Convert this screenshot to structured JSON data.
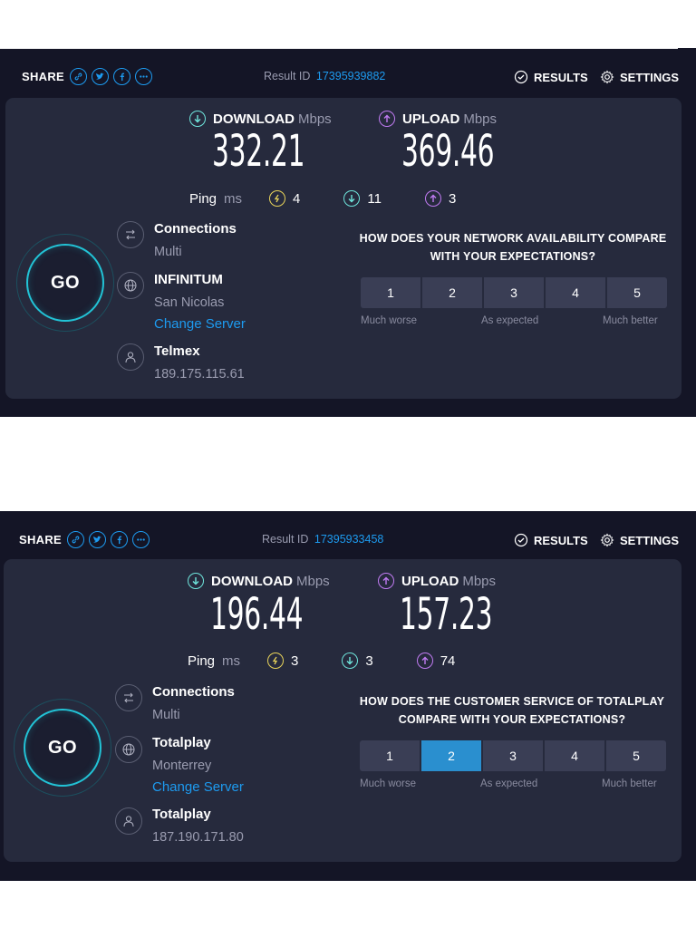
{
  "colors": {
    "accent": "#1d9bf0",
    "download": "#6fe5dc",
    "upload": "#c07bf2",
    "jitter": "#e8d35a",
    "go_ring": "#22c3d6",
    "selected_rating": "#2a8fcf"
  },
  "results": [
    {
      "share_label": "SHARE",
      "result_id_label": "Result ID",
      "result_id": "17395939882",
      "results_label": "RESULTS",
      "settings_label": "SETTINGS",
      "download_label": "DOWNLOAD",
      "upload_label": "UPLOAD",
      "unit": "Mbps",
      "download_value": "332.21",
      "upload_value": "369.46",
      "ping_label": "Ping",
      "ping_unit": "ms",
      "ping_idle": "4",
      "ping_download": "11",
      "ping_upload": "3",
      "go_label": "GO",
      "connections_title": "Connections",
      "connections_value": "Multi",
      "server_title": "INFINITUM",
      "server_location": "San Nicolas",
      "change_server": "Change Server",
      "isp_title": "Telmex",
      "ip_address": "189.175.115.61",
      "question": "HOW DOES YOUR NETWORK AVAILABILITY COMPARE WITH YOUR EXPECTATIONS?",
      "rating_options": [
        "1",
        "2",
        "3",
        "4",
        "5"
      ],
      "selected_rating": null,
      "scale_low": "Much worse",
      "scale_mid": "As expected",
      "scale_high": "Much better"
    },
    {
      "share_label": "SHARE",
      "result_id_label": "Result ID",
      "result_id": "17395933458",
      "results_label": "RESULTS",
      "settings_label": "SETTINGS",
      "download_label": "DOWNLOAD",
      "upload_label": "UPLOAD",
      "unit": "Mbps",
      "download_value": "196.44",
      "upload_value": "157.23",
      "ping_label": "Ping",
      "ping_unit": "ms",
      "ping_idle": "3",
      "ping_download": "3",
      "ping_upload": "74",
      "go_label": "GO",
      "connections_title": "Connections",
      "connections_value": "Multi",
      "server_title": "Totalplay",
      "server_location": "Monterrey",
      "change_server": "Change Server",
      "isp_title": "Totalplay",
      "ip_address": "187.190.171.80",
      "question": "HOW DOES THE CUSTOMER SERVICE OF TOTALPLAY COMPARE WITH YOUR EXPECTATIONS?",
      "rating_options": [
        "1",
        "2",
        "3",
        "4",
        "5"
      ],
      "selected_rating": "2",
      "scale_low": "Much worse",
      "scale_mid": "As expected",
      "scale_high": "Much better"
    }
  ]
}
